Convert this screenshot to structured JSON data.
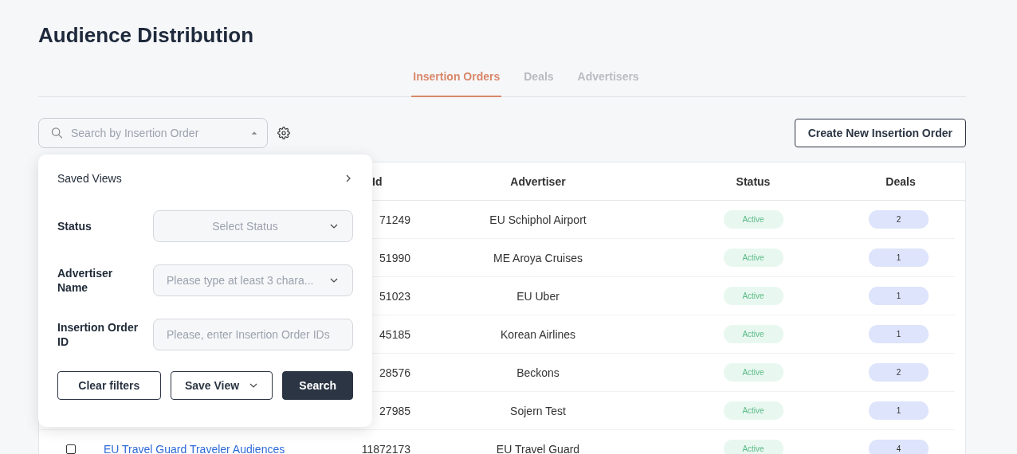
{
  "page": {
    "title": "Audience Distribution"
  },
  "tabs": [
    {
      "label": "Insertion Orders",
      "selected": true
    },
    {
      "label": "Deals",
      "selected": false
    },
    {
      "label": "Advertisers",
      "selected": false
    }
  ],
  "search": {
    "placeholder": "Search by Insertion Order",
    "expanded": true
  },
  "create_button": "Create New Insertion Order",
  "filter_panel": {
    "saved_views": "Saved Views",
    "fields": [
      {
        "kind": "select",
        "label": "Status",
        "placeholder": "Select Status"
      },
      {
        "kind": "select",
        "label": "Advertiser Name",
        "placeholder": "Please type at least 3 chara..."
      },
      {
        "kind": "input",
        "label": "Insertion Order ID",
        "placeholder": "Please, enter Insertion Order IDs"
      }
    ],
    "buttons": [
      {
        "kind": "outline",
        "label": "Clear filters"
      },
      {
        "kind": "menu",
        "label": "Save View"
      },
      {
        "kind": "primary",
        "label": "Search"
      }
    ]
  },
  "table": {
    "columns": [
      "Id",
      "Advertiser",
      "Status",
      "Deals"
    ],
    "rows": [
      {
        "id": "71249",
        "advertiser": "EU Schiphol Airport",
        "status": "Active",
        "deals": "2"
      },
      {
        "id": "51990",
        "advertiser": "ME Aroya Cruises",
        "status": "Active",
        "deals": "1"
      },
      {
        "id": "51023",
        "advertiser": "EU Uber",
        "status": "Active",
        "deals": "1"
      },
      {
        "id": "45185",
        "advertiser": "Korean Airlines",
        "status": "Active",
        "deals": "1"
      },
      {
        "id": "28576",
        "advertiser": "Beckons",
        "status": "Active",
        "deals": "2"
      },
      {
        "id": "27985",
        "advertiser": "Sojern Test",
        "status": "Active",
        "deals": "1"
      },
      {
        "checked": false,
        "name": "EU Travel Guard Traveler Audiences",
        "id": "11872173",
        "advertiser": "EU Travel Guard",
        "status": "Active",
        "deals": "4"
      }
    ]
  }
}
